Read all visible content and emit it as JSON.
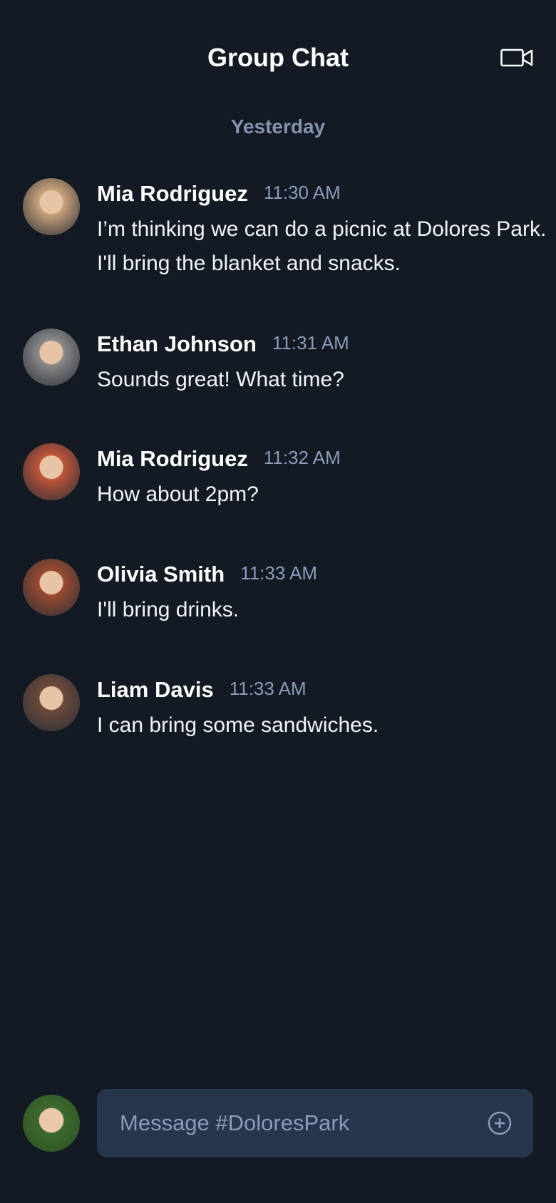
{
  "header": {
    "title": "Group Chat",
    "video_icon": "video-camera-icon"
  },
  "day_label": "Yesterday",
  "messages": [
    {
      "name": "Mia Rodriguez",
      "time": "11:30 AM",
      "text": "I’m thinking we can do a picnic at Dolores Park. I'll bring the blanket and snacks.",
      "avatar_color": "#c9a27a"
    },
    {
      "name": "Ethan Johnson",
      "time": "11:31 AM",
      "text": "Sounds great! What time?",
      "avatar_color": "#8a8a8a"
    },
    {
      "name": "Mia Rodriguez",
      "time": "11:32 AM",
      "text": "How about 2pm?",
      "avatar_color": "#c0553a"
    },
    {
      "name": "Olivia Smith",
      "time": "11:33 AM",
      "text": "I'll bring drinks.",
      "avatar_color": "#9a4a30"
    },
    {
      "name": "Liam Davis",
      "time": "11:33 AM",
      "text": "I can bring some sandwiches.",
      "avatar_color": "#6b4a3a"
    }
  ],
  "composer": {
    "placeholder": "Message #DoloresPark",
    "value": "",
    "add_icon": "plus-circle-icon"
  },
  "colors": {
    "background": "#141a23",
    "input_bg": "#28364d",
    "muted": "#8a9bbb"
  }
}
